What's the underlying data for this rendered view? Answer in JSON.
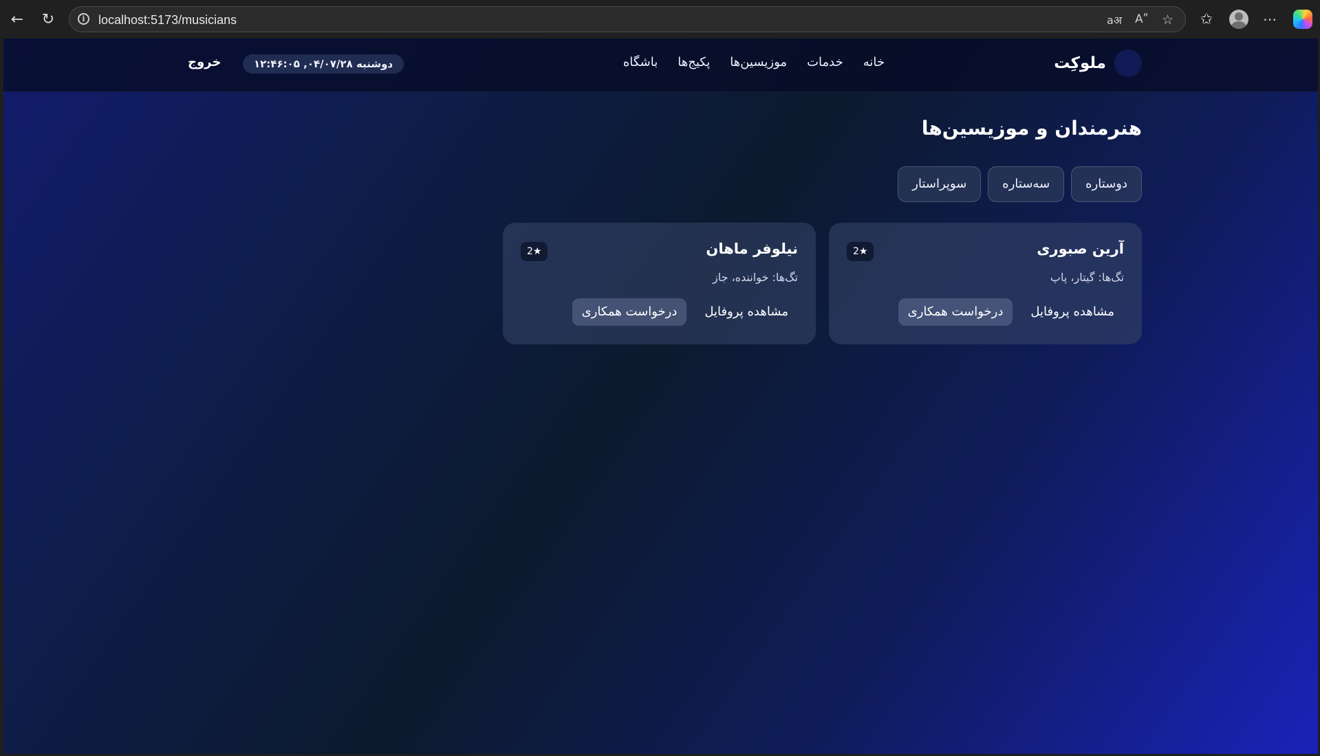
{
  "browser": {
    "url": "localhost:5173/musicians"
  },
  "header": {
    "brand": "ملوکِت",
    "nav": [
      "خانه",
      "خدمات",
      "موزیسین‌ها",
      "پکیج‌ها",
      "باشگاه"
    ],
    "datetime": "دوشنبه ۰۴/۰۷/۲۸, ۱۲:۴۶:۰۵",
    "logout": "خروج"
  },
  "main": {
    "title": "هنرمندان و موزیسین‌ها",
    "filters": [
      "دوستاره",
      "سه‌ستاره",
      "سوپراستار"
    ],
    "cards": [
      {
        "name": "آرین صبوری",
        "badge": "2★",
        "tags": "تگ‌ها: گیتار، پاپ",
        "view_profile": "مشاهده پروفایل",
        "collab_request": "درخواست همکاری"
      },
      {
        "name": "نیلوفر ماهان",
        "badge": "2★",
        "tags": "تگ‌ها: خواننده، جاز",
        "view_profile": "مشاهده پروفایل",
        "collab_request": "درخواست همکاری"
      }
    ]
  },
  "icons": {
    "back": "back-arrow-icon",
    "reload": "reload-icon",
    "info": "site-info-icon",
    "translate": "translate-icon",
    "read_aloud": "read-aloud-icon",
    "favorite": "star-icon",
    "favorites": "favorites-icon",
    "profile": "profile-avatar-icon",
    "more": "more-icon",
    "copilot": "copilot-icon"
  }
}
